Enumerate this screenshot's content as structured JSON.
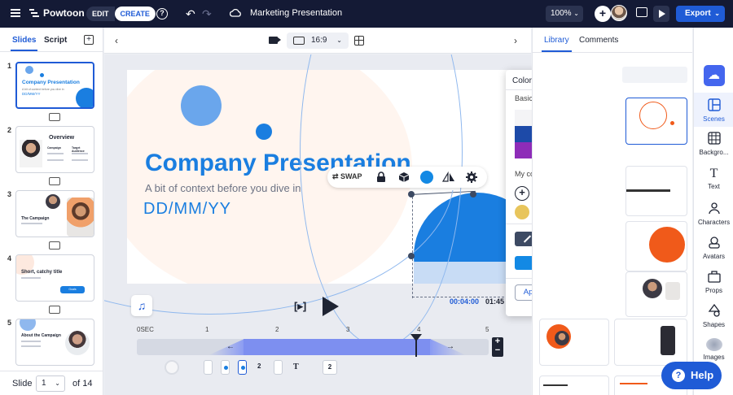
{
  "topbar": {
    "logo_text": "Powtoon",
    "mode_edit": "EDIT",
    "mode_create": "CREATE",
    "help_glyph": "?",
    "project_title": "Marketing Presentation",
    "zoom": "100%",
    "export_label": "Export"
  },
  "left_panel": {
    "tabs": [
      "Slides",
      "Script"
    ],
    "slides": [
      {
        "num": "1",
        "title": "Company Presentation",
        "subtitle": "A bit of context before you dive in",
        "date": "DD/MM/YY"
      },
      {
        "num": "2",
        "title": "Overview",
        "col_a": "Campaign",
        "col_b": "Target Audience"
      },
      {
        "num": "3",
        "title": "The Campaign"
      },
      {
        "num": "4",
        "title": "Short, catchy title",
        "pill": "Goals"
      },
      {
        "num": "5",
        "title": "About the Campaign"
      }
    ],
    "footer": {
      "label": "Slide",
      "current": "1",
      "of": "of 14"
    }
  },
  "canvas_bar": {
    "ratio": "16:9"
  },
  "stage": {
    "title": "Company Presentation",
    "subtitle": "A bit of context before you dive in",
    "date": "DD/MM/YY",
    "swap_label": "SWAP"
  },
  "timeline": {
    "current_time": "00:04:00",
    "end_time": "01:45",
    "ticks": [
      "0SEC",
      "1",
      "2",
      "3",
      "4",
      "5"
    ],
    "layer_counts": [
      "2",
      "2"
    ],
    "text_layer": "T"
  },
  "color_picker": {
    "title": "Color Picker",
    "basic_label": "Basic colors",
    "my_colors_label": "My colors",
    "hex_value": "#1389E4",
    "apply_label": "Apply to matching colors",
    "basic_colors": [
      "#f4f4f6",
      "#d7dae0",
      "#b3b9c4",
      "#7d8796",
      "#454a52",
      "#0d0d10",
      "#1d4aa8",
      "#2585e0",
      "#5ab6f0",
      "#138540",
      "#20b850",
      "#32d8a0",
      "#8e2cb8",
      "#ec4e9e",
      "#f23a48",
      "#f46a1a",
      "#f6a413",
      "#f8e020"
    ],
    "my_colors": [
      "#f29483",
      "#9fd8cf",
      "#df1f2b",
      "#bf9a62",
      "#bf9a62",
      "#e8c55c",
      "#f7e018",
      "#2f4ae6",
      "#8e9ef5",
      "#b0d8f3",
      "#a07cf1"
    ]
  },
  "right_panel": {
    "tabs": [
      "Library",
      "Comments"
    ]
  },
  "rail": {
    "items": [
      "Scenes",
      "Backgro...",
      "Text",
      "Characters",
      "Avatars",
      "Props",
      "Shapes",
      "Images"
    ]
  },
  "help_label": "Help"
}
